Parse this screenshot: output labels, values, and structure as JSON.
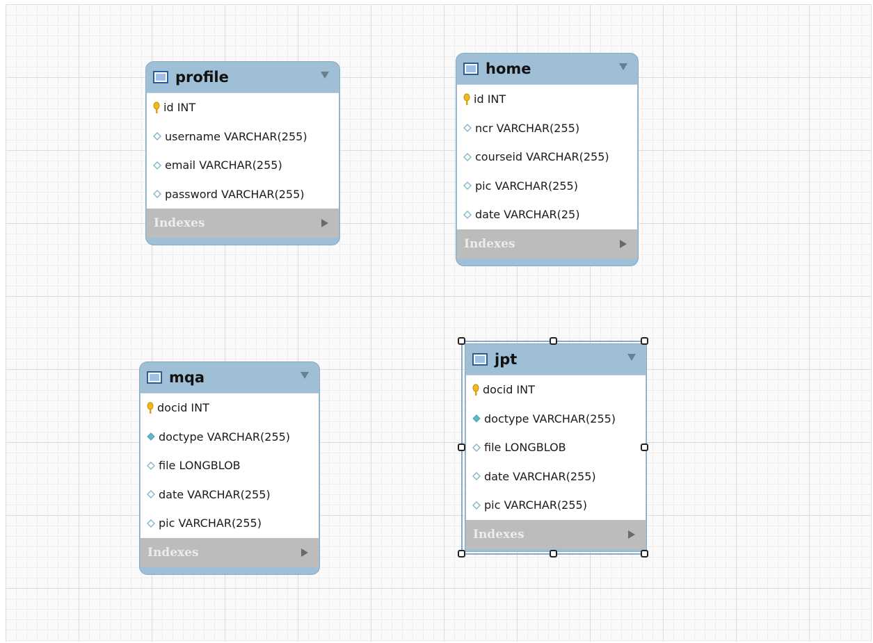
{
  "diagram": {
    "tables": [
      {
        "name": "profile",
        "columns": [
          {
            "text": "id INT",
            "kind": "primary-key"
          },
          {
            "text": "username VARCHAR(255)",
            "kind": "nullable"
          },
          {
            "text": "email VARCHAR(255)",
            "kind": "nullable"
          },
          {
            "text": "password VARCHAR(255)",
            "kind": "nullable"
          }
        ],
        "indexes_label": "Indexes",
        "selected": false
      },
      {
        "name": "home",
        "columns": [
          {
            "text": "id INT",
            "kind": "primary-key"
          },
          {
            "text": "ncr VARCHAR(255)",
            "kind": "nullable"
          },
          {
            "text": "courseid VARCHAR(255)",
            "kind": "nullable"
          },
          {
            "text": "pic VARCHAR(255)",
            "kind": "nullable"
          },
          {
            "text": "date VARCHAR(25)",
            "kind": "nullable"
          }
        ],
        "indexes_label": "Indexes",
        "selected": false
      },
      {
        "name": "mqa",
        "columns": [
          {
            "text": "docid INT",
            "kind": "primary-key"
          },
          {
            "text": "doctype VARCHAR(255)",
            "kind": "not-null"
          },
          {
            "text": "file LONGBLOB",
            "kind": "nullable"
          },
          {
            "text": "date VARCHAR(255)",
            "kind": "nullable"
          },
          {
            "text": "pic VARCHAR(255)",
            "kind": "nullable"
          }
        ],
        "indexes_label": "Indexes",
        "selected": false
      },
      {
        "name": "jpt",
        "columns": [
          {
            "text": "docid INT",
            "kind": "primary-key"
          },
          {
            "text": "doctype VARCHAR(255)",
            "kind": "not-null"
          },
          {
            "text": "file LONGBLOB",
            "kind": "nullable"
          },
          {
            "text": "date VARCHAR(255)",
            "kind": "nullable"
          },
          {
            "text": "pic VARCHAR(255)",
            "kind": "nullable"
          }
        ],
        "indexes_label": "Indexes",
        "selected": true
      }
    ],
    "icons": {
      "table": "table-icon",
      "primary_key": "key-icon",
      "column_not_null": "filled-diamond-icon",
      "column_nullable": "hollow-diamond-icon",
      "collapse": "chevron-down-icon",
      "expand": "play-arrow-icon"
    },
    "colors": {
      "header": "#9fbfd6",
      "key": "#f2b820",
      "diamond_fill": "#5fb8c9",
      "diamond_outline": "#7fb5c8",
      "indexes_bg": "#bcbcbc"
    }
  }
}
